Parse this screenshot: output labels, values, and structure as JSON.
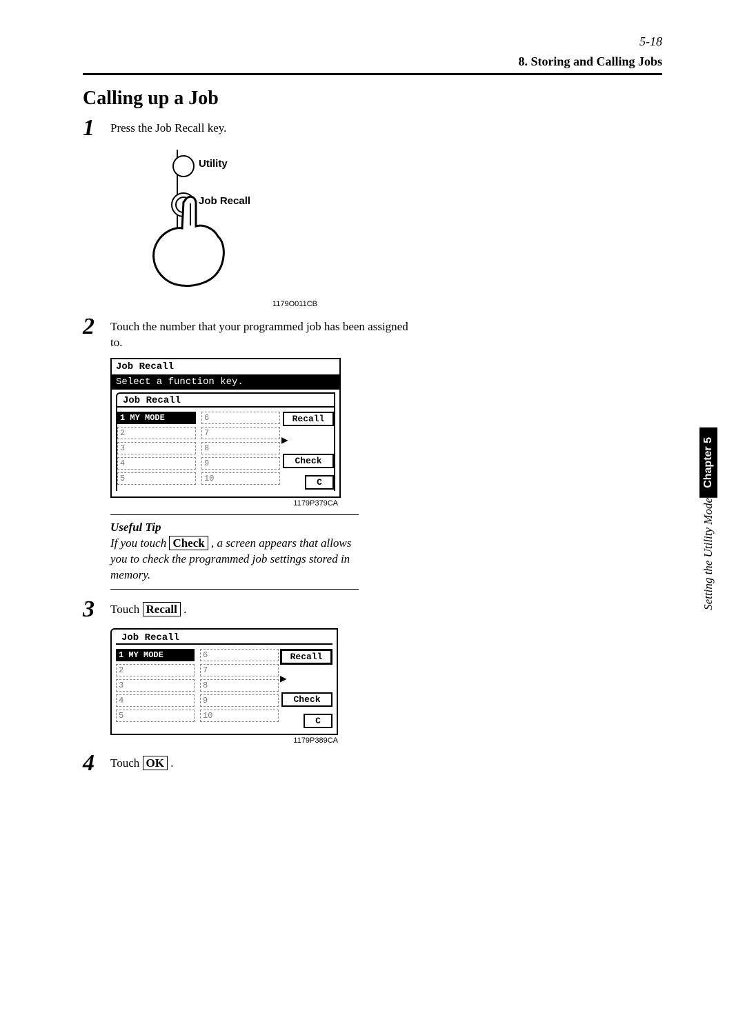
{
  "header": {
    "page_number": "5-18",
    "section": "8. Storing and Calling Jobs"
  },
  "title": "Calling up a Job",
  "steps": {
    "s1": {
      "num": "1",
      "text": "Press the Job Recall key."
    },
    "s2": {
      "num": "2",
      "text": "Touch the number that your programmed job has been assigned to."
    },
    "s3": {
      "num": "3",
      "pre": "Touch ",
      "box": "Recall",
      "post": " ."
    },
    "s4": {
      "num": "4",
      "pre": "Touch ",
      "box": "OK",
      "post": " ."
    }
  },
  "fig1": {
    "utility": "Utility",
    "job_recall": "Job Recall",
    "code": "1179O011CB"
  },
  "fig2": {
    "title": "Job Recall",
    "prompt": "Select a function key.",
    "tab": "Job Recall",
    "mode1": "MY MODE",
    "recall": "Recall",
    "check": "Check",
    "c": "C",
    "code": "1179P379CA"
  },
  "tip": {
    "heading": "Useful Tip",
    "pre": "If you touch ",
    "box": "Check",
    "post": " , a screen appears that allows you to check the programmed job settings stored in memory."
  },
  "fig3": {
    "tab": "Job Recall",
    "mode1": "MY MODE",
    "recall": "Recall",
    "check": "Check",
    "c": "C",
    "code": "1179P389CA"
  },
  "sidebar": {
    "chapter": "Chapter 5",
    "text": "Setting the Utility Mode"
  }
}
